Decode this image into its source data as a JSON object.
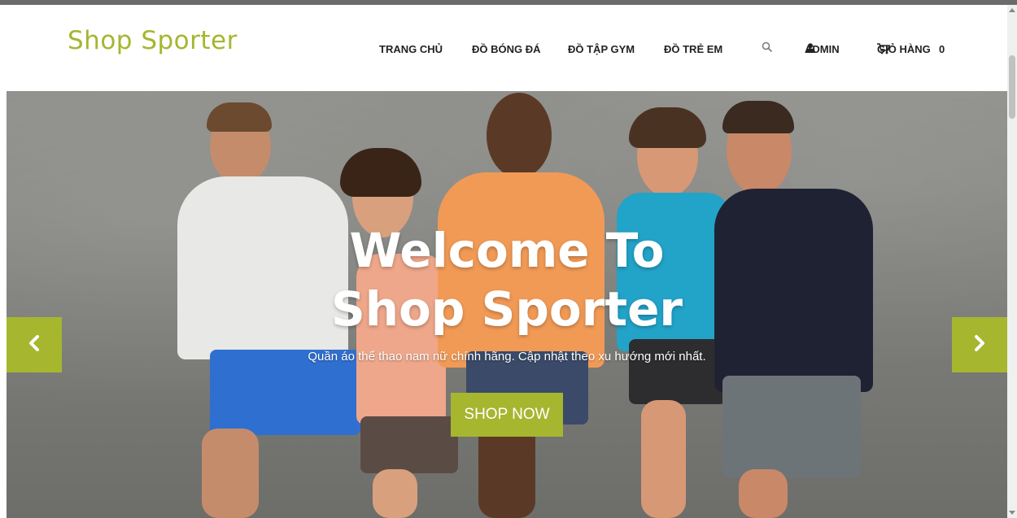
{
  "header": {
    "logo": "Shop Sporter",
    "nav": {
      "home": "TRANG CHỦ",
      "football": "ĐỒ BÓNG ĐÁ",
      "gym": "ĐỒ TẬP GYM",
      "kids": "ĐỒ TRẺ EM",
      "admin": "ADMIN",
      "cart": "GIỎ HÀNG",
      "cart_count": "0"
    },
    "icons": {
      "search": "search-icon",
      "user": "user-icon",
      "cart": "cart-icon"
    }
  },
  "hero": {
    "title_line1": "Welcome To",
    "title_line2": "Shop Sporter",
    "subtitle": "Quần áo thể thao nam nữ chính hãng. Cập nhật theo xu hướng mới nhất.",
    "button": "SHOP NOW",
    "prev_icon": "chevron-left-icon",
    "next_icon": "chevron-right-icon"
  },
  "colors": {
    "accent": "#a6b62f",
    "text": "#222222"
  }
}
